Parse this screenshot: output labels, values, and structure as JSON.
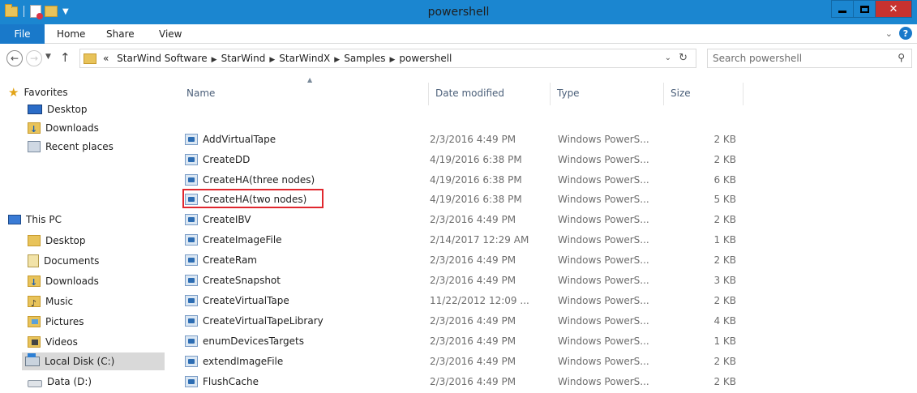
{
  "window": {
    "title": "powershell"
  },
  "ribbon": {
    "tabs": [
      "File",
      "Home",
      "Share",
      "View"
    ]
  },
  "address": {
    "crumbs": [
      "StarWind Software",
      "StarWind",
      "StarWindX",
      "Samples",
      "powershell"
    ],
    "overflow": "«"
  },
  "search": {
    "placeholder": "Search powershell"
  },
  "nav": {
    "favorites_label": "Favorites",
    "favorites": [
      "Desktop",
      "Downloads",
      "Recent places"
    ],
    "thispc_label": "This PC",
    "thispc": [
      "Desktop",
      "Documents",
      "Downloads",
      "Music",
      "Pictures",
      "Videos",
      "Local Disk (C:)",
      "Data (D:)"
    ]
  },
  "columns": {
    "name": "Name",
    "date": "Date modified",
    "type": "Type",
    "size": "Size"
  },
  "files": [
    {
      "name": "AddVirtualTape",
      "date": "2/3/2016 4:49 PM",
      "type": "Windows PowerS...",
      "size": "2 KB"
    },
    {
      "name": "CreateDD",
      "date": "4/19/2016 6:38 PM",
      "type": "Windows PowerS...",
      "size": "2 KB"
    },
    {
      "name": "CreateHA(three nodes)",
      "date": "4/19/2016 6:38 PM",
      "type": "Windows PowerS...",
      "size": "6 KB"
    },
    {
      "name": "CreateHA(two nodes)",
      "date": "4/19/2016 6:38 PM",
      "type": "Windows PowerS...",
      "size": "5 KB"
    },
    {
      "name": "CreateIBV",
      "date": "2/3/2016 4:49 PM",
      "type": "Windows PowerS...",
      "size": "2 KB"
    },
    {
      "name": "CreateImageFile",
      "date": "2/14/2017 12:29 AM",
      "type": "Windows PowerS...",
      "size": "1 KB"
    },
    {
      "name": "CreateRam",
      "date": "2/3/2016 4:49 PM",
      "type": "Windows PowerS...",
      "size": "2 KB"
    },
    {
      "name": "CreateSnapshot",
      "date": "2/3/2016 4:49 PM",
      "type": "Windows PowerS...",
      "size": "3 KB"
    },
    {
      "name": "CreateVirtualTape",
      "date": "11/22/2012 12:09 ...",
      "type": "Windows PowerS...",
      "size": "2 KB"
    },
    {
      "name": "CreateVirtualTapeLibrary",
      "date": "2/3/2016 4:49 PM",
      "type": "Windows PowerS...",
      "size": "4 KB"
    },
    {
      "name": "enumDevicesTargets",
      "date": "2/3/2016 4:49 PM",
      "type": "Windows PowerS...",
      "size": "1 KB"
    },
    {
      "name": "extendImageFile",
      "date": "2/3/2016 4:49 PM",
      "type": "Windows PowerS...",
      "size": "2 KB"
    },
    {
      "name": "FlushCache",
      "date": "2/3/2016 4:49 PM",
      "type": "Windows PowerS...",
      "size": "2 KB"
    }
  ],
  "colors": {
    "titlebar": "#1b86d0",
    "file_tab": "#1979ca",
    "close": "#c7322f",
    "highlight": "#e0272e"
  }
}
